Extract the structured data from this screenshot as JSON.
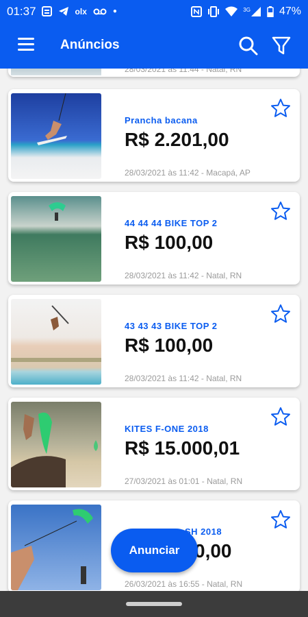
{
  "status": {
    "time": "01:37",
    "carrier_icon": "olx",
    "network": "3G",
    "battery": "47%"
  },
  "appbar": {
    "title": "Anúncios"
  },
  "partial_item": {
    "meta": "28/03/2021 às 11:44 - Natal, RN"
  },
  "listings": [
    {
      "name": "Prancha bacana",
      "price": "R$ 2.201,00",
      "meta": "28/03/2021 às 11:42 - Macapá, AP"
    },
    {
      "name": "44 44 44 BIKE TOP 2",
      "price": "R$ 100,00",
      "meta": "28/03/2021 às 11:42 - Natal, RN"
    },
    {
      "name": "43 43 43 BIKE TOP 2",
      "price": "R$ 100,00",
      "meta": "28/03/2021 às 11:42 - Natal, RN"
    },
    {
      "name": "KITES F-ONE 2018",
      "price": "R$ 15.000,01",
      "meta": "27/03/2021 às 01:01 - Natal, RN"
    },
    {
      "name": "SH 2018",
      "price": "0,00",
      "meta": "26/03/2021 às 16:55 - Natal, RN"
    }
  ],
  "fab": {
    "label": "Anunciar"
  },
  "colors": {
    "primary": "#0a5cf0",
    "text": "#111111",
    "meta": "#9a9a9a"
  }
}
